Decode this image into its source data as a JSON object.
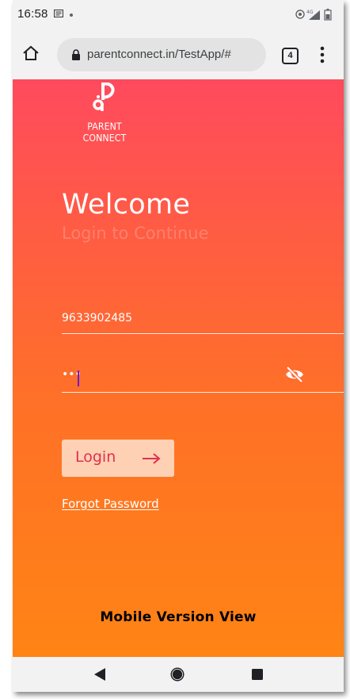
{
  "status_bar": {
    "time": "16:58",
    "icons": [
      "message-icon",
      "notification-dot",
      "hotspot-icon",
      "4g-signal-icon",
      "battery-icon"
    ]
  },
  "browser": {
    "url": "parentconnect.in/TestApp/#",
    "tab_count": "4",
    "icons": [
      "home-icon",
      "lock-icon",
      "tabs-icon",
      "more-vert-icon"
    ]
  },
  "app": {
    "logo_text": "PARENT CONNECT",
    "welcome": "Welcome",
    "subtitle": "Login to Continue",
    "phone_value": "9633902485",
    "password_value": "•••",
    "login_label": "Login",
    "forgot_label": "Forgot Password",
    "caption": "Mobile Version View",
    "colors": {
      "gradient_top": "#ff4a5e",
      "gradient_bottom": "#ff8414",
      "button_bg": "#ffd1b4",
      "button_text": "#e0304f"
    }
  },
  "nav_bar": {
    "icons": [
      "back-icon",
      "home-circle-icon",
      "recents-icon"
    ]
  }
}
